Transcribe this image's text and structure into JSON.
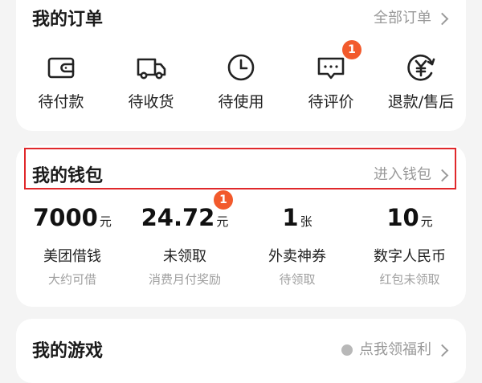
{
  "orders": {
    "title": "我的订单",
    "all_link": "全部订单",
    "items": [
      {
        "label": "待付款",
        "icon": "wallet-icon"
      },
      {
        "label": "待收货",
        "icon": "delivery-truck-icon"
      },
      {
        "label": "待使用",
        "icon": "clock-icon"
      },
      {
        "label": "待评价",
        "icon": "comment-icon",
        "badge": "1"
      },
      {
        "label": "退款/售后",
        "icon": "yuan-refund-icon"
      }
    ]
  },
  "wallet": {
    "title": "我的钱包",
    "enter_link": "进入钱包",
    "items": [
      {
        "amount": "7000",
        "unit": "元",
        "label": "美团借钱",
        "sub": "大约可借"
      },
      {
        "amount": "24.72",
        "unit": "元",
        "label": "未领取",
        "sub": "消费月付奖励",
        "badge": "1"
      },
      {
        "amount": "1",
        "unit": "张",
        "label": "外卖神券",
        "sub": "待领取"
      },
      {
        "amount": "10",
        "unit": "元",
        "label": "数字人民币",
        "sub": "红包未领取"
      }
    ]
  },
  "games": {
    "title": "我的游戏",
    "benefit_link": "点我领福利"
  },
  "colors": {
    "badge": "#f25a2c",
    "highlight": "#e0282b",
    "muted": "#999999"
  }
}
